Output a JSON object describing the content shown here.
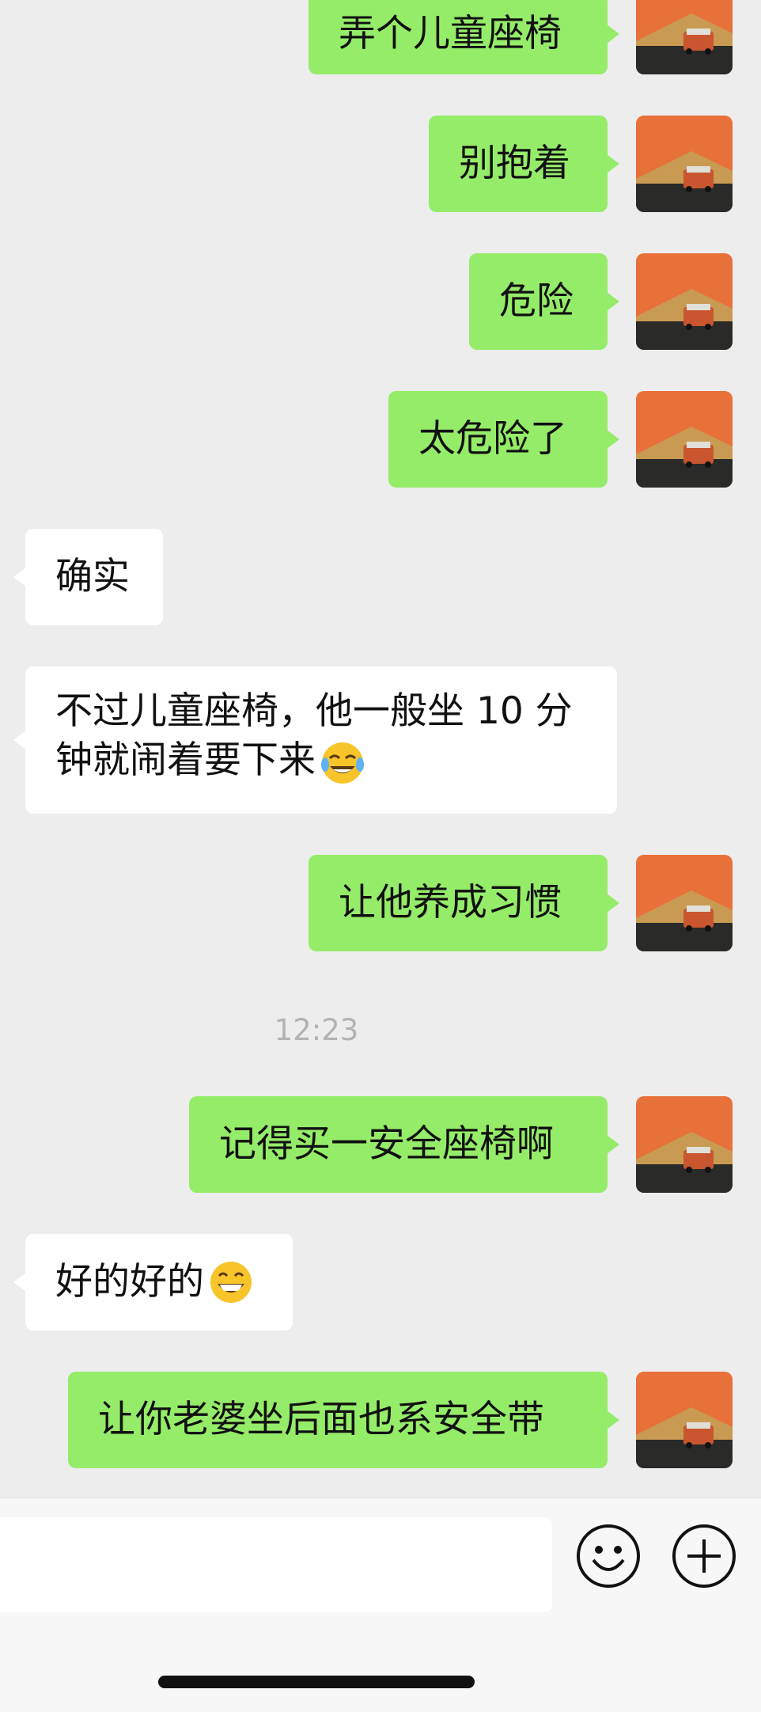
{
  "messages": [
    {
      "side": "me",
      "text": "弄个儿童座椅"
    },
    {
      "side": "me",
      "text": "别抱着"
    },
    {
      "side": "me",
      "text": "危险"
    },
    {
      "side": "me",
      "text": "太危险了"
    },
    {
      "side": "them",
      "text": "确实"
    },
    {
      "side": "them",
      "lines": [
        "不过儿童座椅，他一般坐 10 分",
        "钟就闹着要下来"
      ],
      "emoji": "tears-of-joy"
    },
    {
      "side": "me",
      "text": "让他养成习惯"
    },
    {
      "side": "me",
      "text": "记得买一安全座椅啊"
    },
    {
      "side": "them",
      "text": "好的好的",
      "emoji": "grinning"
    },
    {
      "side": "me",
      "text": "让你老婆坐后面也系安全带"
    }
  ],
  "timestamp": "12:23",
  "input": {
    "placeholder": ""
  },
  "icons": {
    "emoji_button": "smiley-icon",
    "add_button": "plus-circle-icon"
  },
  "colors": {
    "my_bubble": "#95ec69",
    "their_bubble": "#ffffff",
    "background": "#ededed"
  }
}
